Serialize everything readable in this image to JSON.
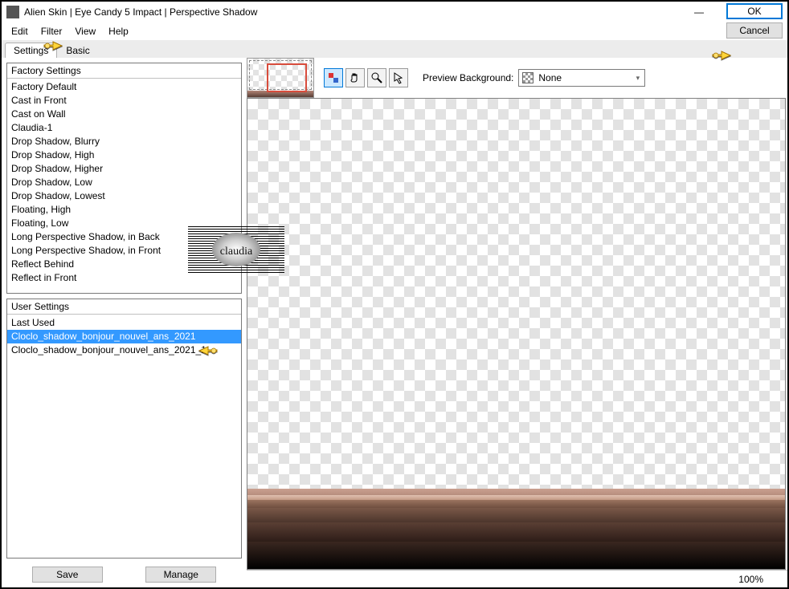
{
  "window": {
    "title": "Alien Skin | Eye Candy 5 Impact | Perspective Shadow"
  },
  "menu": {
    "items": [
      "Edit",
      "Filter",
      "View",
      "Help"
    ]
  },
  "tabs": {
    "items": [
      {
        "label": "Settings",
        "active": true
      },
      {
        "label": "Basic",
        "active": false
      }
    ]
  },
  "factory": {
    "header": "Factory Settings",
    "items": [
      "Factory Default",
      "Cast in Front",
      "Cast on Wall",
      "Claudia-1",
      "Drop Shadow, Blurry",
      "Drop Shadow, High",
      "Drop Shadow, Higher",
      "Drop Shadow, Low",
      "Drop Shadow, Lowest",
      "Floating, High",
      "Floating, Low",
      "Long Perspective Shadow, in Back",
      "Long Perspective Shadow, in Front",
      "Reflect Behind",
      "Reflect in Front"
    ]
  },
  "user": {
    "header": "User Settings",
    "items": [
      {
        "label": "Last Used",
        "selected": false
      },
      {
        "label": "Cloclo_shadow_bonjour_nouvel_ans_2021",
        "selected": true
      },
      {
        "label": "Cloclo_shadow_bonjour_nouvel_ans_2021_1",
        "selected": false
      }
    ]
  },
  "buttons": {
    "save": "Save",
    "manage": "Manage",
    "ok": "OK",
    "cancel": "Cancel"
  },
  "toolbar": {
    "preview_bg_label": "Preview Background:",
    "preview_bg_value": "None"
  },
  "status": {
    "zoom": "100%"
  },
  "watermark": {
    "text": "claudia"
  }
}
